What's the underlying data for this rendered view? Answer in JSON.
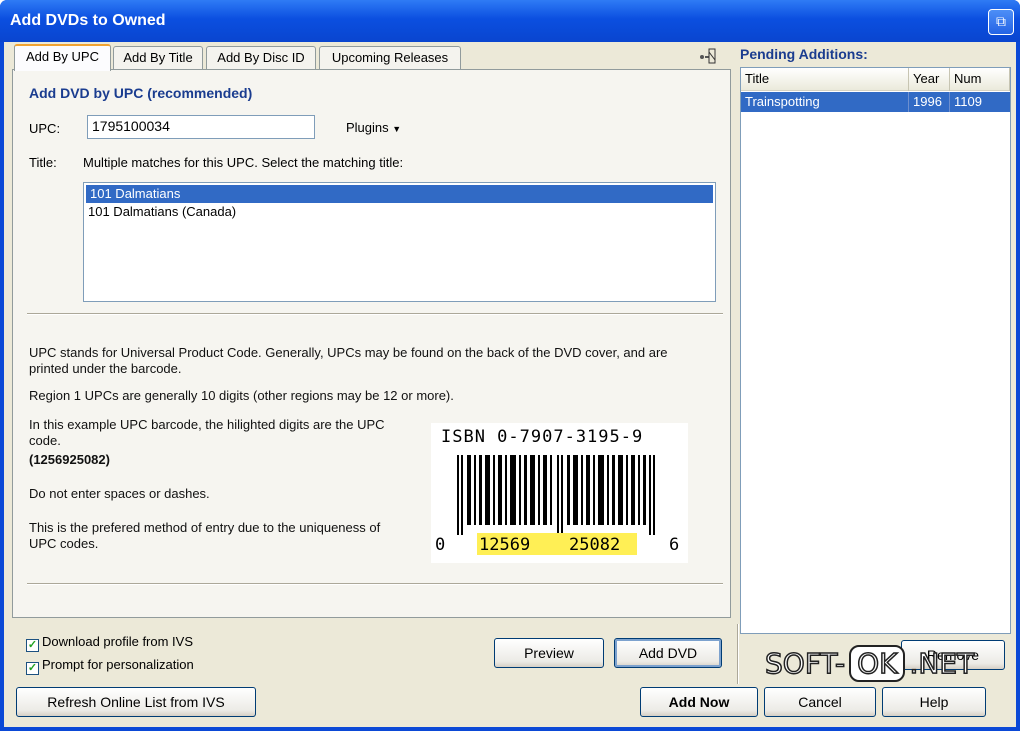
{
  "window": {
    "title": "Add DVDs to Owned"
  },
  "tabs": [
    {
      "label": "Add By UPC"
    },
    {
      "label": "Add By Title"
    },
    {
      "label": "Add By Disc ID"
    },
    {
      "label": "Upcoming Releases"
    }
  ],
  "upc_panel": {
    "heading": "Add DVD by UPC (recommended)",
    "upc_label": "UPC:",
    "upc_value": "1795100034",
    "plugins_label": "Plugins",
    "title_label": "Title:",
    "title_hint": "Multiple matches for this UPC.  Select the matching title:",
    "matches": [
      "101 Dalmatians",
      "101 Dalmatians (Canada)"
    ],
    "info": {
      "p1": "UPC stands for Universal Product Code.  Generally, UPCs may be found on the back of the DVD cover, and are printed under the barcode.",
      "p2": "Region 1 UPCs are generally 10 digits (other regions may be 12 or more).",
      "p3": "In this example UPC barcode, the hilighted digits are the UPC code.",
      "p3_code": "(1256925082)",
      "p4": "Do not enter spaces or dashes.",
      "p5": "This is the prefered method of entry due to the uniqueness of UPC codes."
    },
    "barcode": {
      "isbn": "ISBN 0-7907-3195-9",
      "lead": "0",
      "left_digits": "12569",
      "right_digits": "25082",
      "trail": "6"
    }
  },
  "options": {
    "download_profile": "Download profile from IVS",
    "prompt_personalization": "Prompt for personalization"
  },
  "buttons": {
    "preview": "Preview",
    "add_dvd": "Add DVD",
    "remove": "Remove",
    "refresh": "Refresh Online List from IVS",
    "add_now": "Add Now",
    "cancel": "Cancel",
    "help": "Help"
  },
  "pending": {
    "heading": "Pending Additions:",
    "columns": [
      "Title",
      "Year",
      "Num"
    ],
    "rows": [
      {
        "title": "Trainspotting",
        "year": "1996",
        "num": "1109"
      }
    ]
  },
  "watermark": {
    "left": "SOFT-",
    "ok": "OK",
    "right": ".NET"
  }
}
